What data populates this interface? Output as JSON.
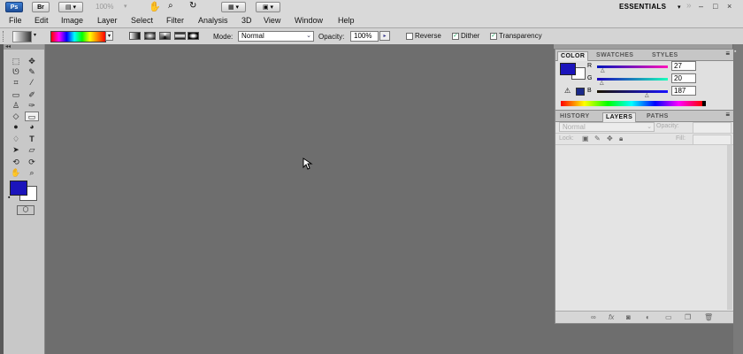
{
  "app": {
    "logo": "Ps",
    "bridge": "Br",
    "zoom": "100%",
    "workspace": "ESSENTIALS",
    "window_controls": [
      "–",
      "□",
      "×"
    ]
  },
  "menu": [
    "File",
    "Edit",
    "Image",
    "Layer",
    "Select",
    "Filter",
    "Analysis",
    "3D",
    "View",
    "Window",
    "Help"
  ],
  "options": {
    "mode_label": "Mode:",
    "mode_value": "Normal",
    "opacity_label": "Opacity:",
    "opacity_value": "100%",
    "reverse_label": "Reverse",
    "reverse_checked": false,
    "dither_label": "Dither",
    "dither_checked": true,
    "transparency_label": "Transparency",
    "transparency_checked": true
  },
  "color_panel": {
    "tabs": [
      "COLOR",
      "SWATCHES",
      "STYLES"
    ],
    "active_tab": "COLOR",
    "channels": [
      {
        "label": "R",
        "value": "27"
      },
      {
        "label": "G",
        "value": "20"
      },
      {
        "label": "B",
        "value": "187"
      }
    ],
    "foreground": "#1b14bb",
    "background": "#ffffff"
  },
  "layers_panel": {
    "tabs": [
      "HISTORY",
      "LAYERS",
      "PATHS"
    ],
    "active_tab": "LAYERS",
    "blend_mode": "Normal",
    "opacity_label": "Opacity:",
    "lock_label": "Lock:",
    "fill_label": "Fill:"
  },
  "icons": {
    "cursor": "arrow-cursor-icon"
  }
}
